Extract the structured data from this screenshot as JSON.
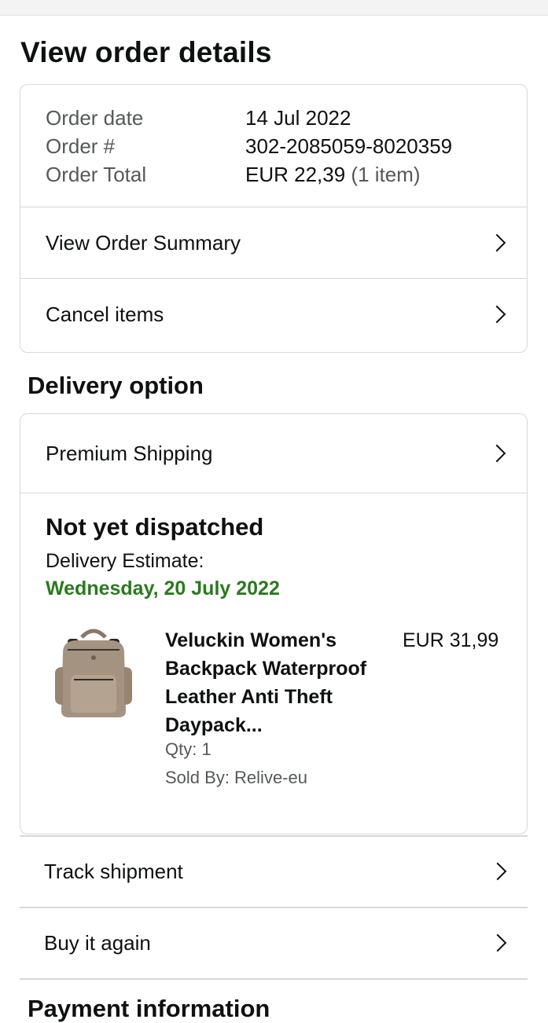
{
  "page": {
    "title": "View order details"
  },
  "order": {
    "date_label": "Order date",
    "date_value": "14 Jul 2022",
    "number_label": "Order #",
    "number_value": "302-2085059-8020359",
    "total_label": "Order Total",
    "total_value": "EUR 22,39",
    "total_items": "(1 item)",
    "links": [
      {
        "label": "View Order Summary"
      },
      {
        "label": "Cancel items"
      }
    ]
  },
  "delivery": {
    "section_title": "Delivery option",
    "option_label": "Premium Shipping",
    "status": "Not yet dispatched",
    "estimate_label": "Delivery Estimate:",
    "estimate_date": "Wednesday, 20 July 2022",
    "product": {
      "title": "Veluckin Women's Backpack Waterproof Leather Anti Theft Daypack...",
      "price": "EUR 31,99",
      "qty": "Qty: 1",
      "sold_by": "Sold By: Relive-eu",
      "image_icon": "backpack-image"
    }
  },
  "actions": [
    {
      "label": "Track shipment"
    },
    {
      "label": "Buy it again"
    }
  ],
  "next_section": {
    "title": "Payment information"
  },
  "colors": {
    "estimate_green": "#2a7a1f",
    "border": "#d5d9d9",
    "muted": "#565959"
  }
}
